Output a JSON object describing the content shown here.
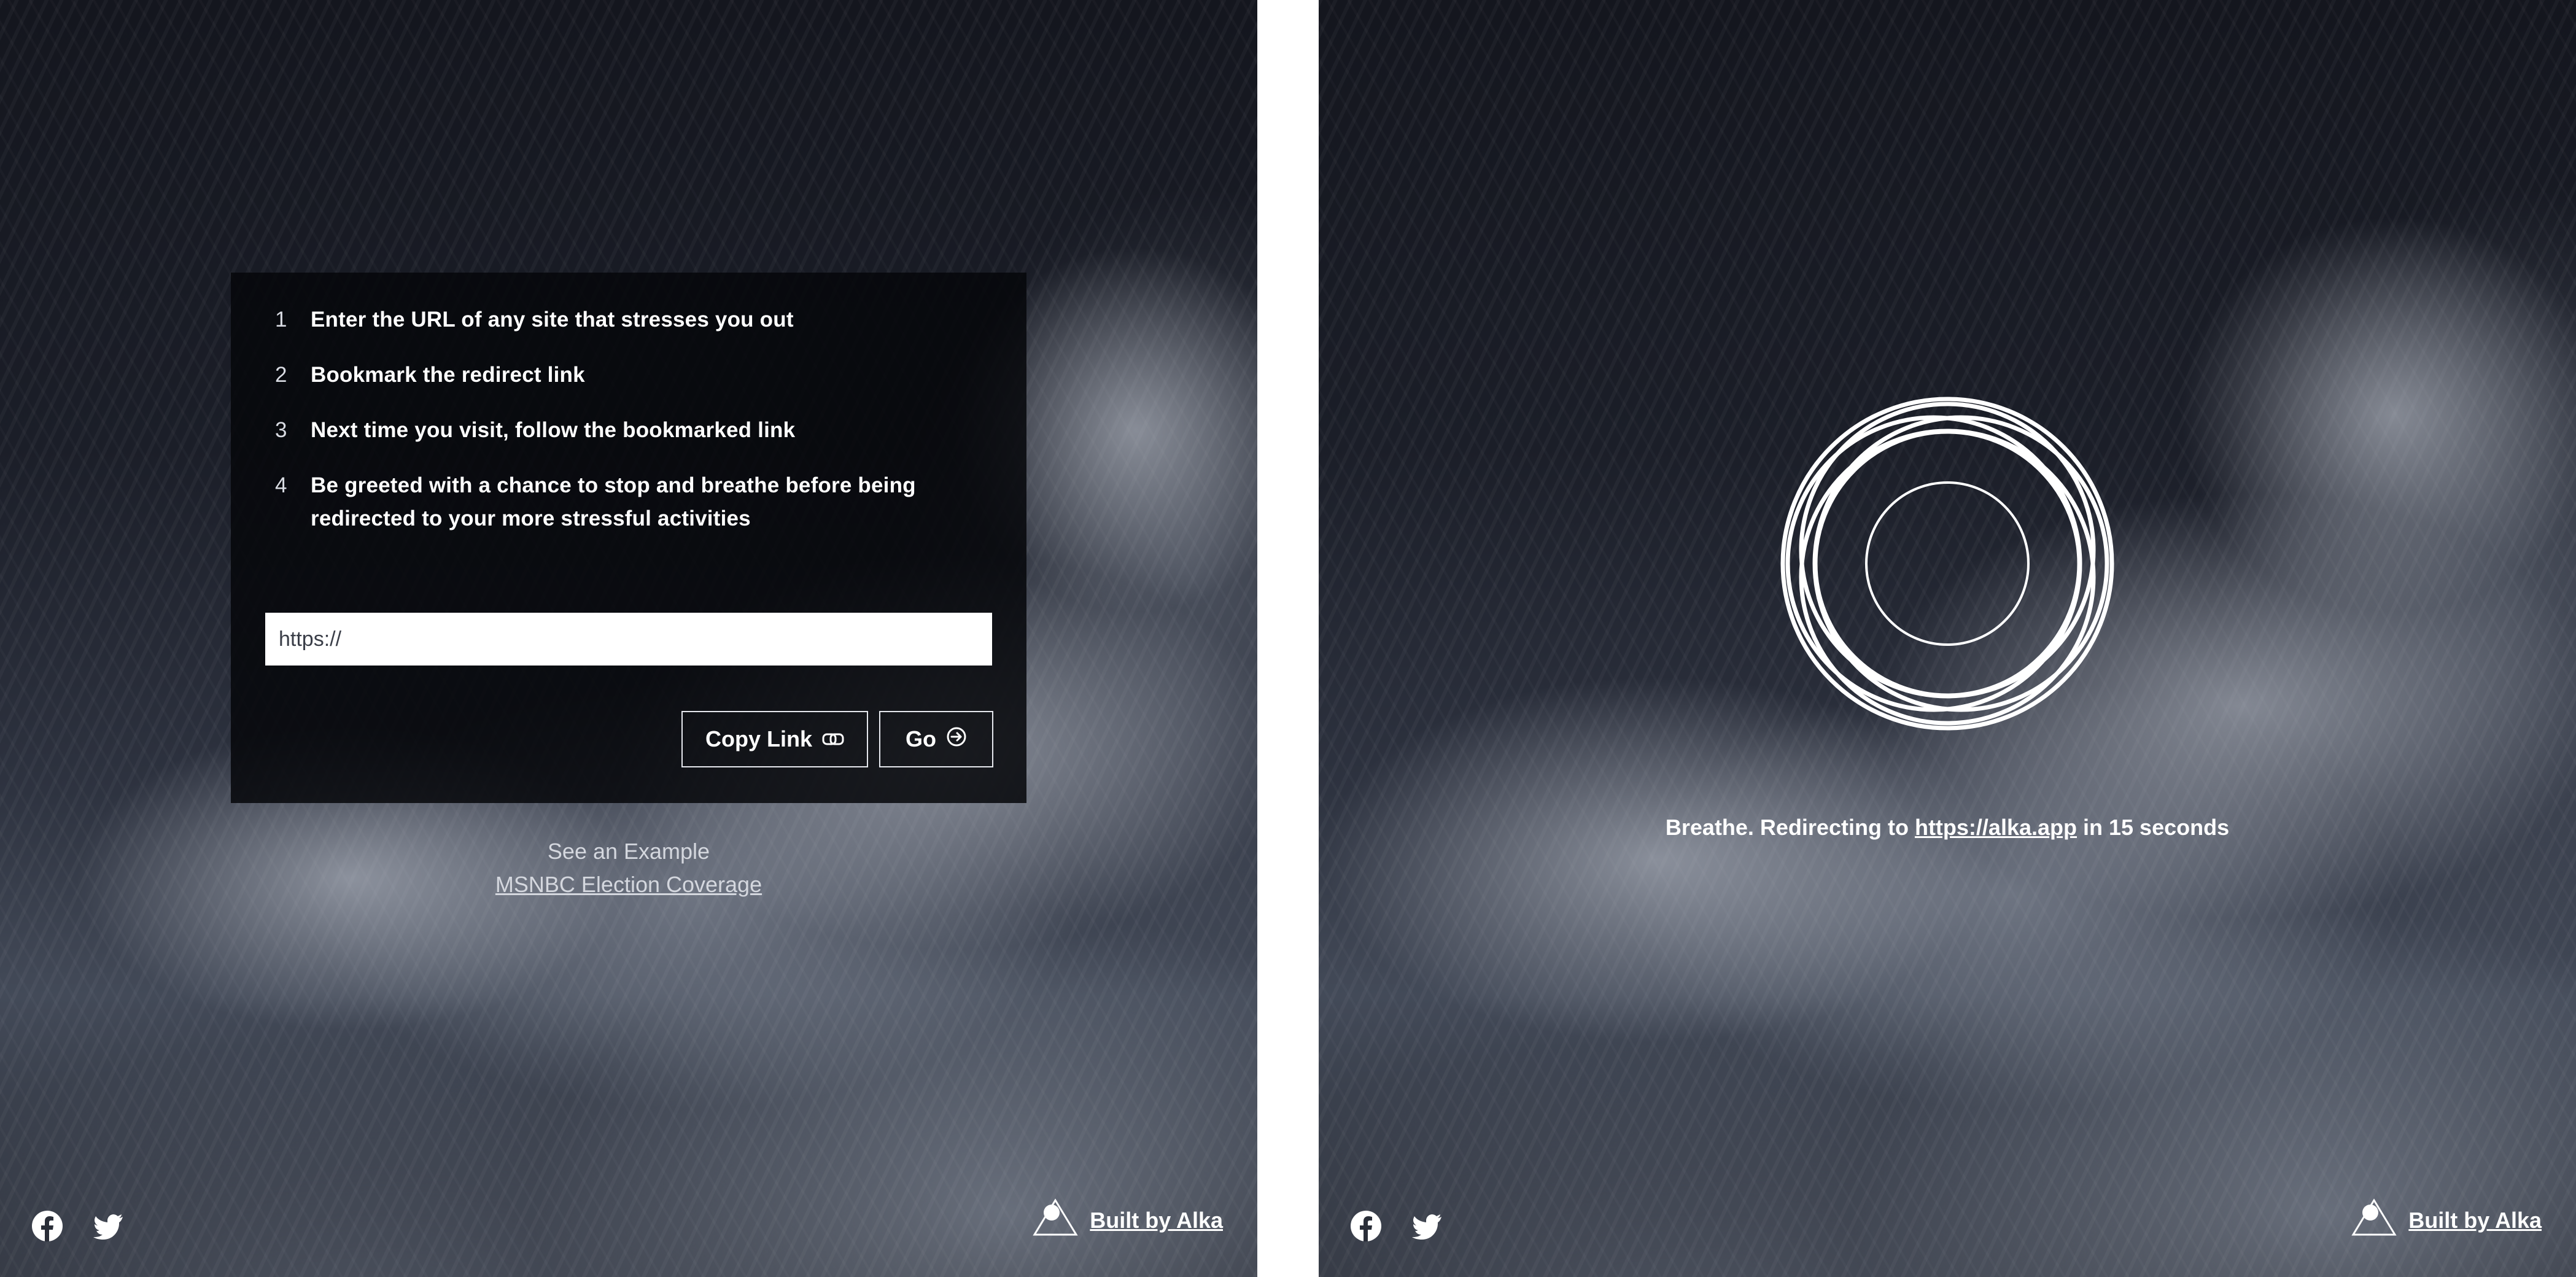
{
  "left": {
    "steps": [
      {
        "num": "1",
        "text": "Enter the URL of any site that stresses you out"
      },
      {
        "num": "2",
        "text": "Bookmark the redirect link"
      },
      {
        "num": "3",
        "text": "Next time you visit, follow the bookmarked link"
      },
      {
        "num": "4",
        "text": "Be greeted with a chance to stop and breathe before being redirected to your more stressful activities"
      }
    ],
    "url_input": {
      "value": "https://"
    },
    "copy_link_label": "Copy Link",
    "go_label": "Go",
    "example_title": "See an Example",
    "example_link": "MSNBC Election Coverage"
  },
  "right": {
    "msg_prefix": "Breathe. Redirecting to",
    "msg_link": "https://alka.app",
    "msg_suffix": "in 15 seconds"
  },
  "footer": {
    "social_icons": [
      "facebook-icon",
      "twitter-icon"
    ],
    "built_by_label": "Built by Alka"
  },
  "colors": {
    "card_bg": "#06070b",
    "text": "#ffffff",
    "button_border": "#e6e8ee"
  }
}
